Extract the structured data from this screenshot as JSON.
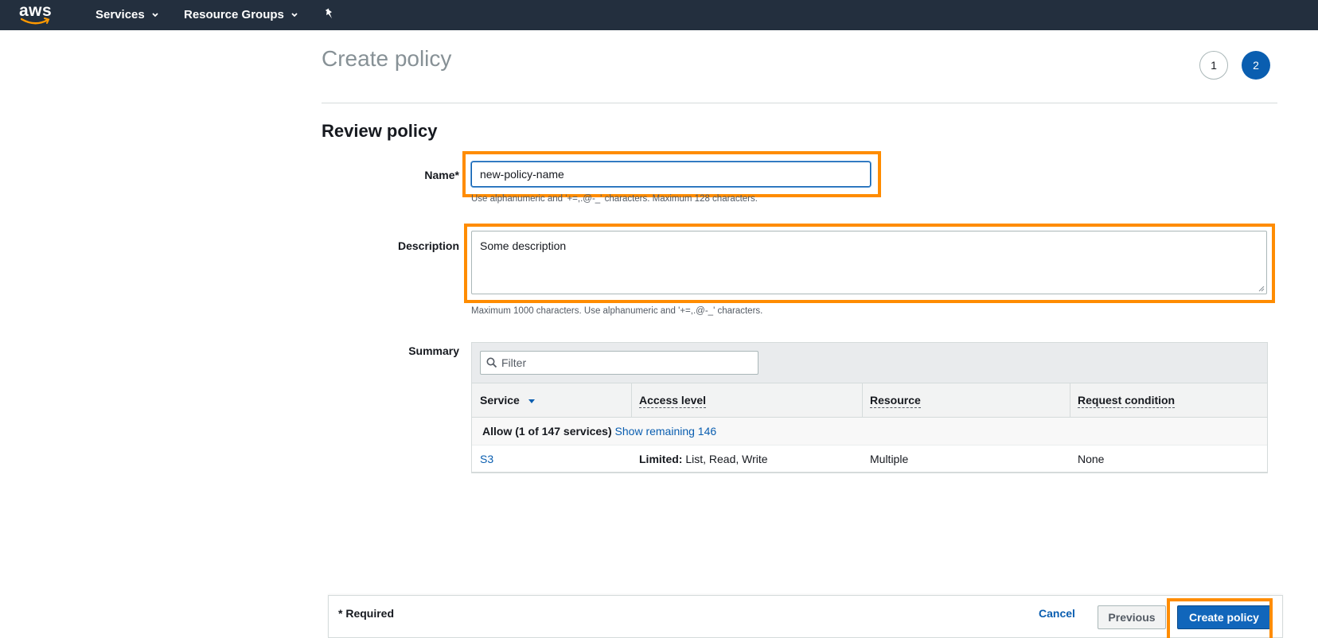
{
  "nav": {
    "logo_text": "aws",
    "services_label": "Services",
    "resource_groups_label": "Resource Groups"
  },
  "header": {
    "title": "Create policy",
    "steps": [
      "1",
      "2"
    ],
    "active_step": "2"
  },
  "review": {
    "section_title": "Review policy",
    "name_label": "Name*",
    "name_value": "new-policy-name",
    "name_hint": "Use alphanumeric and '+=,.@-_' characters. Maximum 128 characters.",
    "description_label": "Description",
    "description_value": "Some description",
    "description_hint": "Maximum 1000 characters. Use alphanumeric and '+=,.@-_' characters.",
    "summary_label": "Summary"
  },
  "summary_table": {
    "filter_placeholder": "Filter",
    "columns": [
      "Service",
      "Access level",
      "Resource",
      "Request condition"
    ],
    "group": {
      "label": "Allow (1 of 147 services)",
      "link": "Show remaining 146"
    },
    "rows": [
      {
        "service": "S3",
        "access_prefix": "Limited:",
        "access_rest": " List, Read, Write",
        "resource": "Multiple",
        "condition": "None"
      }
    ]
  },
  "footer": {
    "required": "* Required",
    "cancel": "Cancel",
    "previous": "Previous",
    "create": "Create policy"
  },
  "colors": {
    "nav_bg": "#232f3e",
    "highlight": "#ff8c00",
    "primary": "#1166bb",
    "link": "#0a5eb0"
  }
}
